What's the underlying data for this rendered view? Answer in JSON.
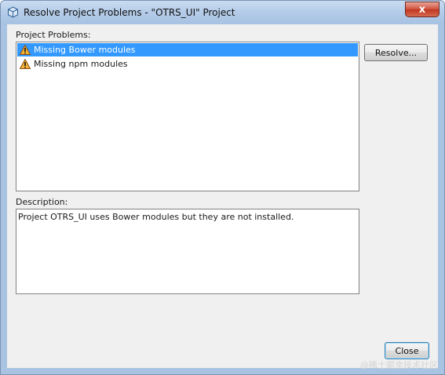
{
  "window": {
    "title": "Resolve Project Problems - \"OTRS_UI\" Project",
    "close_glyph": "x"
  },
  "problems": {
    "label": "Project Problems:",
    "items": [
      {
        "label": "Missing Bower modules",
        "icon": "warning-icon",
        "selected": true
      },
      {
        "label": "Missing npm modules",
        "icon": "warning-icon",
        "selected": false
      }
    ],
    "resolve_label": "Resolve..."
  },
  "description": {
    "label": "Description:",
    "text": "Project OTRS_UI uses Bower modules but they are not installed."
  },
  "footer": {
    "close_label": "Close",
    "watermark": "@稀土掘金技术社区"
  },
  "colors": {
    "selection": "#3399ff",
    "titlebar": "#b6cde9"
  }
}
